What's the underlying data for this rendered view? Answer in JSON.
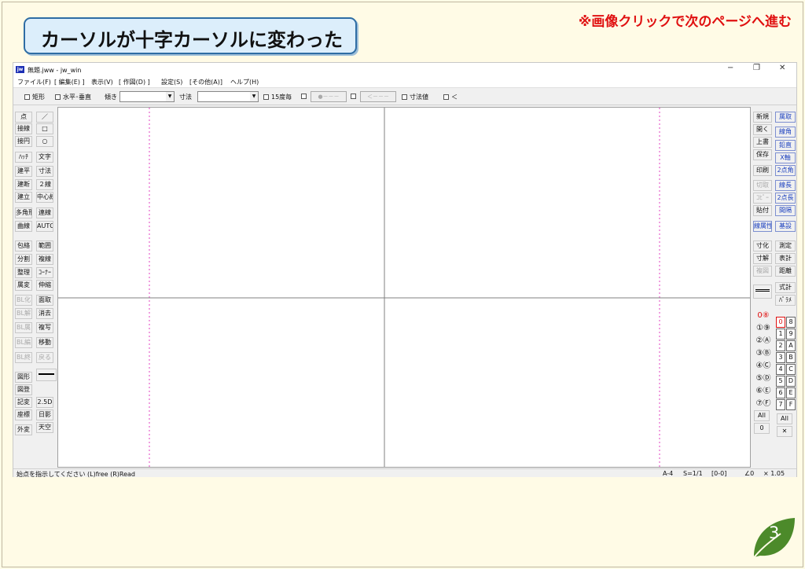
{
  "slide": {
    "title": "カーソルが十字カーソルに変わった",
    "notice": "※画像クリックで次のページへ進む",
    "page_number": "3"
  },
  "window": {
    "icon_text": "jw",
    "title": "無題.jww - jw_win",
    "controls": [
      "−",
      "❐",
      "✕"
    ]
  },
  "menu": [
    "ファイル(F)",
    "[ 編集(E) ]",
    "表示(V)",
    "[ 作図(D) ]",
    "設定(S)",
    "[その他(A)]",
    "ヘルプ(H)"
  ],
  "toolbar": {
    "rect_label": "矩形",
    "hv_label": "水平･垂直",
    "tilt_label": "傾き",
    "tilt_value": "",
    "dim_label": "寸法",
    "dim_value": "",
    "deg15_label": "15度毎",
    "arrow1": "●－－－",
    "arrow2": "＜－－－",
    "dimval_label": "寸法値",
    "lt_label": "＜"
  },
  "left_tools_a": [
    "点",
    "接線",
    "接円",
    "ﾊｯﾁ",
    "建平",
    "建断",
    "建立",
    "多角形",
    "曲線",
    "包絡",
    "分割",
    "整理",
    "属変",
    "BL化",
    "BL解",
    "BL属",
    "BL編",
    "BL終",
    "図形",
    "図登",
    "記変",
    "座標",
    "外変"
  ],
  "left_tools_b": [
    "／",
    "□",
    "○",
    "文字",
    "寸法",
    "２線",
    "中心線",
    "連線",
    "AUTO",
    "範囲",
    "複線",
    "ｺｰﾅｰ",
    "伸縮",
    "面取",
    "消去",
    "複写",
    "移動",
    "戻る",
    "",
    "2.5D",
    "日影",
    "天空"
  ],
  "right_tools_a": [
    "新規",
    "開く",
    "上書",
    "保存",
    "印刷",
    "切取",
    "ｺﾋﾟｰ",
    "貼付",
    "線属性",
    "寸化",
    "寸解",
    "複図"
  ],
  "right_tools_b": [
    "属取",
    "線角",
    "鉛直",
    "X軸",
    "2点角",
    "線長",
    "2点長",
    "間隔",
    "基設",
    "測定",
    "表計",
    "距離",
    "式計",
    "ﾊﾟﾗﾒ"
  ],
  "layer_groups": [
    "0⑧",
    "①⑨",
    "②Ⓐ",
    "③Ⓑ",
    "④Ⓒ",
    "⑤Ⓓ",
    "⑥Ⓔ",
    "⑦Ⓕ"
  ],
  "layer_all": "All",
  "layer_zero": "0",
  "layers": [
    "0",
    "8",
    "1",
    "9",
    "2",
    "A",
    "3",
    "B",
    "4",
    "C",
    "5",
    "D",
    "6",
    "E",
    "7",
    "F"
  ],
  "layers_all": "All",
  "layers_x": "✕",
  "status": {
    "message": "始点を指示してください (L)free (R)Read",
    "paper": "A-4",
    "scale": "S=1/1",
    "layer": "[0-0]",
    "angle": "∠0",
    "zoom": "× 1.05"
  },
  "colors": {
    "accent_red": "#e01010",
    "title_border": "#2e6da4",
    "badge_green": "#4c8a2a",
    "guide_magenta": "#e040c0"
  }
}
